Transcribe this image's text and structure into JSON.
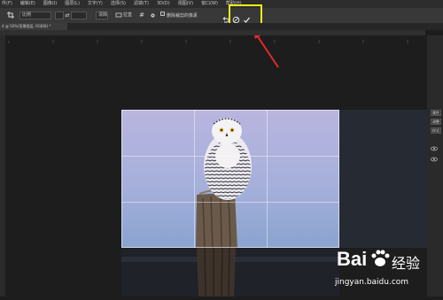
{
  "menu": [
    "件(F)",
    "编辑(E)",
    "图像(I)",
    "图层(L)",
    "文字(Y)",
    "选择(S)",
    "滤镜(T)",
    "3D(D)",
    "视图(V)",
    "窗口(W)",
    "帮助(H)"
  ],
  "options": {
    "ratio_value": "比例",
    "swap_icon": "⇄",
    "clear_button": "清除",
    "straighten_label": "拉直",
    "overlay_icon": "#",
    "settings_icon": "gear-icon",
    "delete_checkbox_label": "删除裁剪的像素",
    "reset_icon": "undo-icon",
    "cancel_icon": "cancel-icon",
    "commit_icon": "checkmark-icon",
    "highlight_color": "#f6ee17"
  },
  "document_tab": "4 @ 50%(背景图层, RGB/8) *",
  "right_panel": [
    "属性",
    "调整",
    "样式"
  ],
  "annotation": {
    "arrow_color": "#e8282a"
  },
  "watermark": {
    "brand_text": "Bai",
    "brand_suffix": "经验",
    "url": "jingyan.baidu.com"
  },
  "colors": {
    "menu_bg": "#2d2d2d",
    "toolbar_bg": "#383838",
    "canvas_bg": "#1d1d1d",
    "sky_top": "#b7b6de",
    "sky_bottom": "#8fa6cf"
  }
}
